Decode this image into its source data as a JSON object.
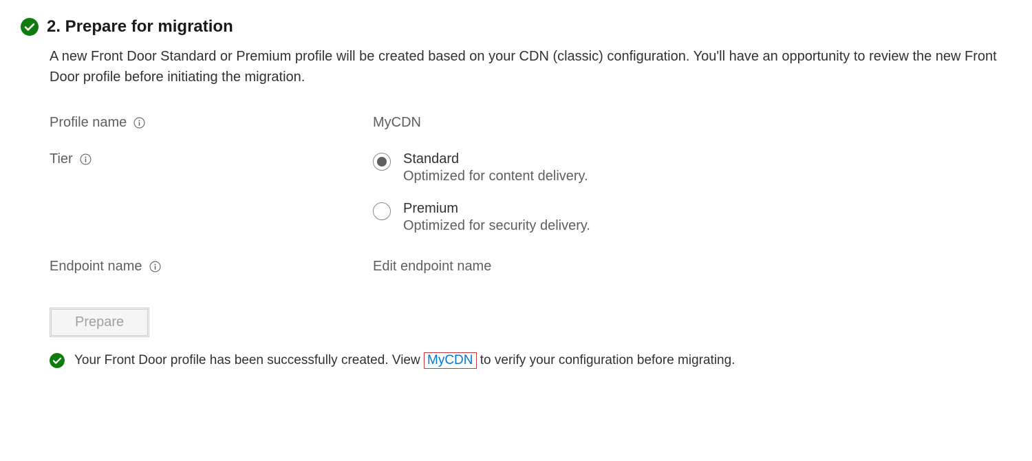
{
  "section": {
    "title": "2. Prepare for migration",
    "description": "A new Front Door Standard or Premium profile will be created based on your CDN (classic) configuration. You'll have an opportunity to review the new Front Door profile before initiating the migration."
  },
  "form": {
    "profile_name_label": "Profile name",
    "profile_name_value": "MyCDN",
    "tier_label": "Tier",
    "tier_options": {
      "standard": {
        "label": "Standard",
        "desc": "Optimized for content delivery."
      },
      "premium": {
        "label": "Premium",
        "desc": "Optimized for security delivery."
      }
    },
    "endpoint_name_label": "Endpoint name",
    "endpoint_name_value": "Edit endpoint name"
  },
  "prepare_button": "Prepare",
  "status": {
    "prefix": "Your Front Door profile has been successfully created. View ",
    "link": "MyCDN",
    "suffix": " to verify your configuration before migrating."
  }
}
